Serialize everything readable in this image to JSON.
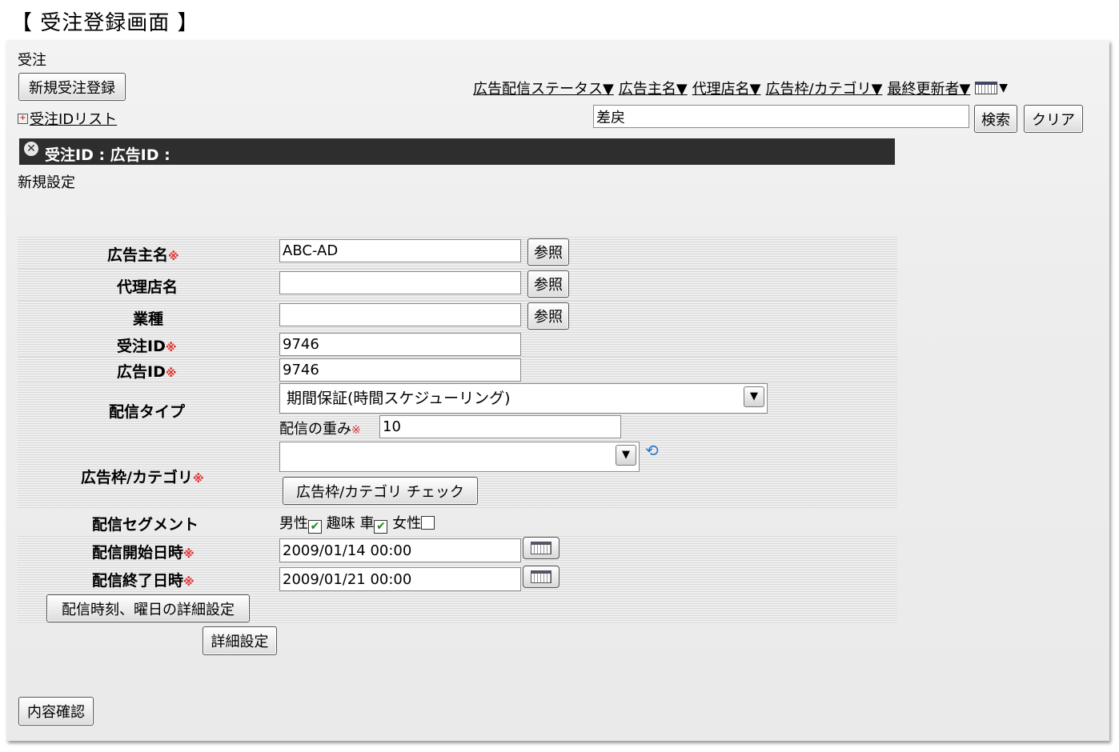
{
  "page_title": "【 受注登録画面 】",
  "section_label": "受注",
  "new_order_button": "新規受注登録",
  "filter_links": [
    "広告配信ステータス▼",
    "広告主名▼",
    "代理店名▼",
    "広告枠/カテゴリ▼",
    "最終更新者▼"
  ],
  "order_id_list_link": "受注IDリスト",
  "search": {
    "value": "差戻",
    "search_button": "検索",
    "clear_button": "クリア"
  },
  "header_bar": {
    "title": "受注ID : 広告ID :"
  },
  "mode_label": "新規設定",
  "required_mark": "※",
  "form": {
    "advertiser": {
      "label": "広告主名",
      "value": "ABC-AD",
      "ref_button": "参照"
    },
    "agency": {
      "label": "代理店名",
      "value": "",
      "ref_button": "参照"
    },
    "industry": {
      "label": "業種",
      "value": "",
      "ref_button": "参照"
    },
    "order_id": {
      "label": "受注ID",
      "value": "9746"
    },
    "ad_id": {
      "label": "広告ID",
      "value": "9746"
    },
    "delivery_type": {
      "label": "配信タイプ",
      "selected": "期間保証(時間スケジューリング)",
      "weight_label": "配信の重み",
      "weight_value": "10"
    },
    "ad_slot": {
      "label": "広告枠/カテゴリ",
      "selected": "",
      "check_button": "広告枠/カテゴリ チェック"
    },
    "segment": {
      "label": "配信セグメント",
      "options": [
        {
          "label": "男性",
          "checked": true
        },
        {
          "label": "趣味 車",
          "checked": true
        },
        {
          "label": "女性",
          "checked": false
        }
      ]
    },
    "start_datetime": {
      "label": "配信開始日時",
      "value": "2009/01/14 00:00"
    },
    "end_datetime": {
      "label": "配信終了日時",
      "value": "2009/01/21 00:00"
    },
    "schedule_button": "配信時刻、曜日の詳細設定",
    "detail_button": "詳細設定"
  },
  "confirm_button": "内容確認",
  "icons": {
    "column_picker": "table-icon",
    "refresh": "refresh-icon",
    "calendar": "calendar-icon",
    "close": "close-icon",
    "expand": "plus-box-icon"
  }
}
